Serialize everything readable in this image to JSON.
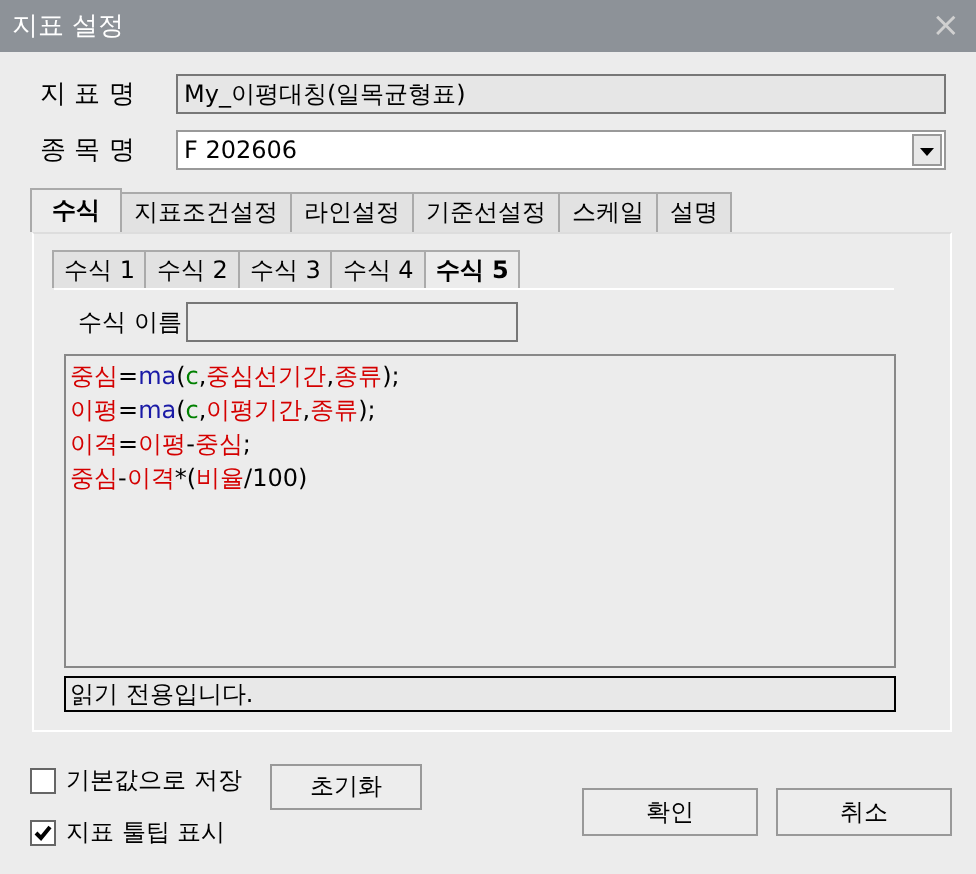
{
  "window": {
    "title": "지표 설정",
    "close": "×"
  },
  "fields": [
    {
      "label": "지 표 명",
      "kind": "readonly",
      "value": "My_이평대칭(일목균형표)"
    },
    {
      "label": "종 목 명",
      "kind": "dropdown",
      "value": "F 202606"
    }
  ],
  "tabs": [
    {
      "label": "수식",
      "selected": true
    },
    {
      "label": "지표조건설정",
      "selected": false
    },
    {
      "label": "라인설정",
      "selected": false
    },
    {
      "label": "기준선설정",
      "selected": false
    },
    {
      "label": "스케일",
      "selected": false
    },
    {
      "label": "설명",
      "selected": false
    }
  ],
  "subtabs": [
    {
      "label": "수식 1",
      "selected": false
    },
    {
      "label": "수식 2",
      "selected": false
    },
    {
      "label": "수식 3",
      "selected": false
    },
    {
      "label": "수식 4",
      "selected": false
    },
    {
      "label": "수식 5",
      "selected": true
    }
  ],
  "formula_name": {
    "label": "수식 이름"
  },
  "code_lines": [
    [
      {
        "text": "중심",
        "kind": "var"
      },
      {
        "text": "=",
        "kind": "op"
      },
      {
        "text": "ma",
        "kind": "func"
      },
      {
        "text": "(",
        "kind": "op"
      },
      {
        "text": "c",
        "kind": "field"
      },
      {
        "text": ",",
        "kind": "op"
      },
      {
        "text": "중심선기간",
        "kind": "var"
      },
      {
        "text": ",",
        "kind": "op"
      },
      {
        "text": "종류",
        "kind": "var"
      },
      {
        "text": ");",
        "kind": "op"
      }
    ],
    [
      {
        "text": "이평",
        "kind": "var"
      },
      {
        "text": "=",
        "kind": "op"
      },
      {
        "text": "ma",
        "kind": "func"
      },
      {
        "text": "(",
        "kind": "op"
      },
      {
        "text": "c",
        "kind": "field"
      },
      {
        "text": ",",
        "kind": "op"
      },
      {
        "text": "이평기간",
        "kind": "var"
      },
      {
        "text": ",",
        "kind": "op"
      },
      {
        "text": "종류",
        "kind": "var"
      },
      {
        "text": ");",
        "kind": "op"
      }
    ],
    [
      {
        "text": "이격",
        "kind": "var"
      },
      {
        "text": "=",
        "kind": "op"
      },
      {
        "text": "이평",
        "kind": "var"
      },
      {
        "text": "-",
        "kind": "op"
      },
      {
        "text": "중심",
        "kind": "var"
      },
      {
        "text": ";",
        "kind": "op"
      }
    ],
    [
      {
        "text": "중심",
        "kind": "var"
      },
      {
        "text": "-",
        "kind": "op"
      },
      {
        "text": "이격",
        "kind": "var"
      },
      {
        "text": "*(",
        "kind": "op"
      },
      {
        "text": "비율",
        "kind": "var"
      },
      {
        "text": "/100)",
        "kind": "op"
      }
    ]
  ],
  "status": "읽기 전용입니다.",
  "checkboxes": [
    {
      "label": "기본값으로 저장",
      "checked": false
    },
    {
      "label": "지표 툴팁 표시",
      "checked": true
    }
  ],
  "reset_button": "초기화",
  "buttons": [
    "확인",
    "취소"
  ]
}
